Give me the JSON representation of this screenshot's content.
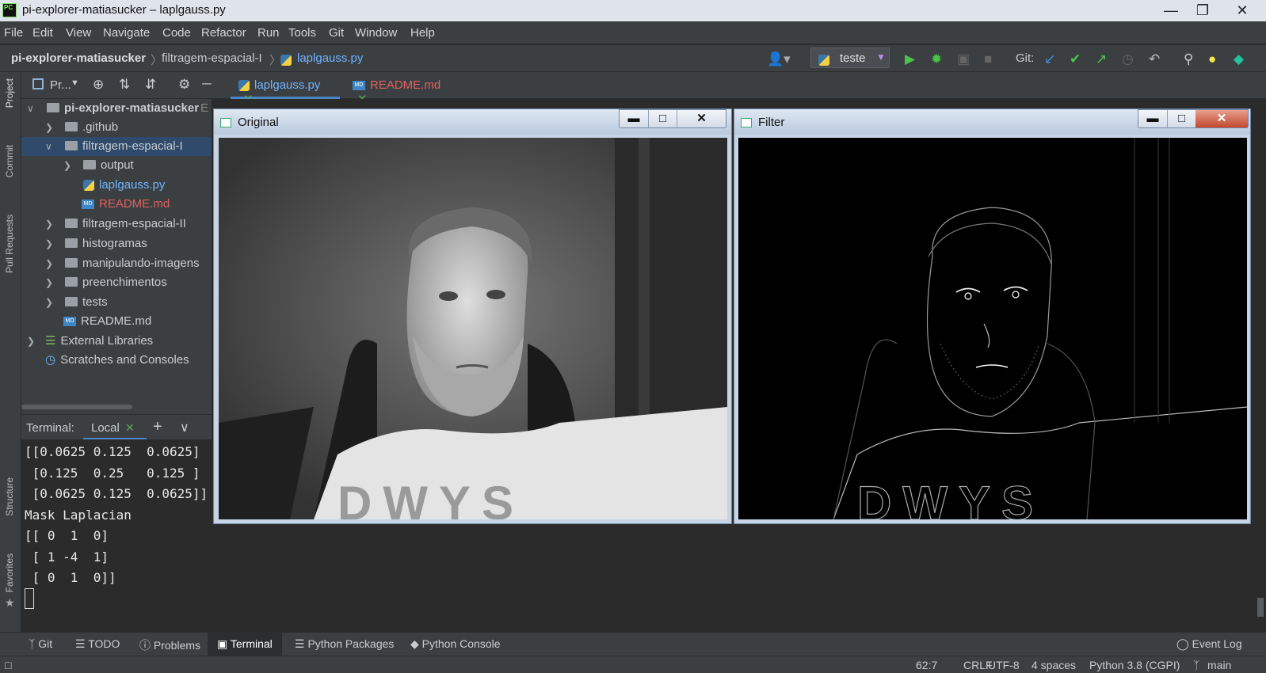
{
  "window": {
    "title": "pi-explorer-matiasucker – laplgauss.py",
    "app_icon": "PC"
  },
  "menu": [
    "File",
    "Edit",
    "View",
    "Navigate",
    "Code",
    "Refactor",
    "Run",
    "Tools",
    "Git",
    "Window",
    "Help"
  ],
  "breadcrumb": {
    "project": "pi-explorer-matiasucker",
    "folder": "filtragem-espacial-I",
    "file": "laplgauss.py"
  },
  "toolbar": {
    "run_config": "teste",
    "git_label": "Git:"
  },
  "project_panel": {
    "title": "Pr...",
    "partial_hint": "E"
  },
  "editor_tabs": [
    {
      "label": "laplgauss.py",
      "color": "#6fb3ff"
    },
    {
      "label": "README.md",
      "color": "#e06060"
    }
  ],
  "tree": [
    {
      "label": "pi-explorer-matiasucker",
      "type": "folder",
      "depth": 0,
      "open": true
    },
    {
      "label": ".github",
      "type": "folder",
      "depth": 1
    },
    {
      "label": "filtragem-espacial-I",
      "type": "folder",
      "depth": 1,
      "open": true,
      "selected": true
    },
    {
      "label": "output",
      "type": "folder",
      "depth": 2
    },
    {
      "label": "laplgauss.py",
      "type": "py",
      "depth": 2
    },
    {
      "label": "README.md",
      "type": "md",
      "depth": 2,
      "color": "#e06060"
    },
    {
      "label": "filtragem-espacial-II",
      "type": "folder",
      "depth": 1
    },
    {
      "label": "histogramas",
      "type": "folder",
      "depth": 1
    },
    {
      "label": "manipulando-imagens",
      "type": "folder",
      "depth": 1
    },
    {
      "label": "preenchimentos",
      "type": "folder",
      "depth": 1
    },
    {
      "label": "tests",
      "type": "folder",
      "depth": 1
    },
    {
      "label": "README.md",
      "type": "md",
      "depth": 1
    },
    {
      "label": "External Libraries",
      "type": "lib",
      "depth": 0
    },
    {
      "label": "Scratches and Consoles",
      "type": "scratch",
      "depth": 0
    }
  ],
  "sidebar_tools": [
    "Project",
    "Commit",
    "Pull Requests",
    "Structure",
    "Favorites"
  ],
  "terminal": {
    "label": "Terminal:",
    "tab": "Local",
    "lines": [
      "[[0.0625 0.125  0.0625]",
      " [0.125  0.25   0.125 ]",
      " [0.0625 0.125  0.0625]]",
      "Mask Laplacian",
      "[[ 0  1  0]",
      " [ 1 -4  1]",
      " [ 0  1  0]]"
    ]
  },
  "windows": {
    "original": "Original",
    "filter": "Filter",
    "shirt_text": "DWYS"
  },
  "bottom_tabs": [
    "Git",
    "TODO",
    "Problems",
    "Terminal",
    "Python Packages",
    "Python Console"
  ],
  "event_log": "Event Log",
  "status": {
    "position": "62:7",
    "line_sep": "CRLF",
    "encoding": "UTF-8",
    "indent": "4 spaces",
    "interpreter": "Python 3.8 (CGPI)",
    "branch": "main"
  }
}
